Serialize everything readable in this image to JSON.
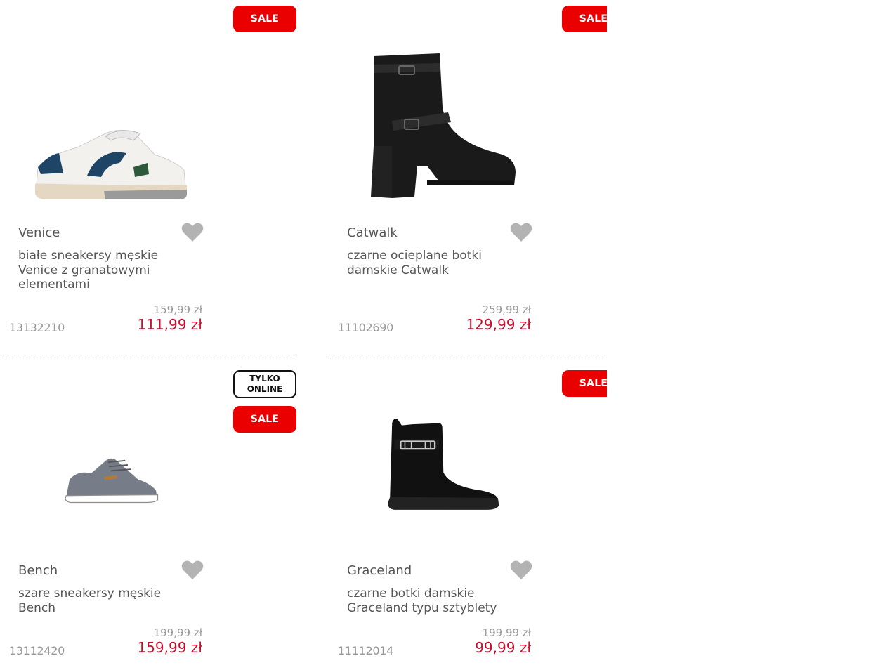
{
  "products": [
    {
      "brand": "Venice",
      "title": "białe sneakersy męskie Venice z granatowymi elementami",
      "old_price": "159,99",
      "old_currency": "zł",
      "new_price": "111,99 zł",
      "sku": "13132210",
      "badges": [
        "SALE"
      ]
    },
    {
      "brand": "Catwalk",
      "title": "czarne ocieplane botki damskie Catwalk",
      "old_price": "259,99",
      "old_currency": "zł",
      "new_price": "129,99 zł",
      "sku": "11102690",
      "badges": [
        "SALE"
      ]
    },
    {
      "brand": "Bench",
      "title": "szare sneakersy męskie Bench",
      "old_price": "199,99",
      "old_currency": "zł",
      "new_price": "159,99 zł",
      "sku": "13112420",
      "badges": [
        "TYLKO ONLINE",
        "SALE"
      ],
      "online_line1": "TYLKO",
      "online_line2": "ONLINE"
    },
    {
      "brand": "Graceland",
      "title": "czarne botki damskie Graceland typu sztyblety",
      "old_price": "199,99",
      "old_currency": "zł",
      "new_price": "99,99 zł",
      "sku": "11112014",
      "badges": [
        "SALE"
      ]
    }
  ],
  "colors": {
    "sale_badge": "#ea0000",
    "new_price": "#c8102e",
    "old_price": "#999999",
    "heart": "#b3b3b3"
  },
  "icons": {
    "wishlist": "heart-icon"
  }
}
